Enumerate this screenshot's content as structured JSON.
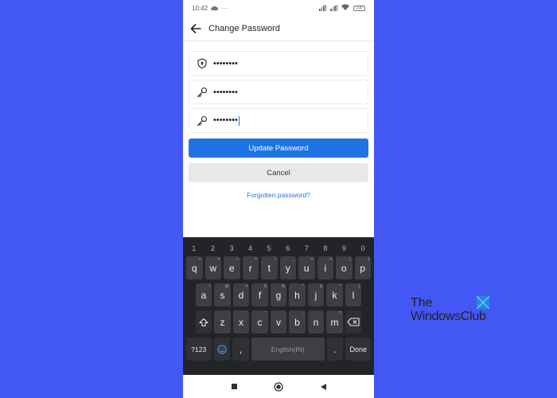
{
  "status_bar": {
    "time": "10:42",
    "battery_level": "100"
  },
  "header": {
    "title": "Change Password"
  },
  "form": {
    "current_password_value": "••••••••",
    "new_password_value": "••••••••",
    "confirm_password_value": "••••••••",
    "update_label": "Update Password",
    "cancel_label": "Cancel",
    "forgot_label": "Forgotten password?"
  },
  "keyboard": {
    "numbers": [
      "1",
      "2",
      "3",
      "4",
      "5",
      "6",
      "7",
      "8",
      "9",
      "0"
    ],
    "row1": [
      "q",
      "w",
      "e",
      "r",
      "t",
      "y",
      "u",
      "i",
      "o",
      "p"
    ],
    "row1_hints": [
      "+",
      "×",
      "÷",
      "=",
      "/",
      "_",
      "<",
      ">",
      "[",
      "]"
    ],
    "row2": [
      "a",
      "s",
      "d",
      "f",
      "g",
      "h",
      "j",
      "k",
      "l"
    ],
    "row2_hints": [
      "!",
      "@",
      "#",
      "$",
      "%",
      "^",
      "&",
      "*",
      "("
    ],
    "row3": [
      "z",
      "x",
      "c",
      "v",
      "b",
      "n",
      "m"
    ],
    "row3_hints": [
      "-",
      "'",
      "\"",
      ":",
      ";",
      ",",
      "?"
    ],
    "symbols_label": "?123",
    "comma_label": ",",
    "space_label": "English(IN)",
    "period_label": ".",
    "done_label": "Done",
    "shift_icon": "shift-icon",
    "backspace_icon": "backspace-icon",
    "emoji_icon": "emoji-icon"
  },
  "watermark": {
    "line1": "The",
    "line2": "WindowsClub"
  },
  "colors": {
    "background": "#4357f5",
    "primary": "#1e74e3",
    "keyboard": "#232428",
    "key": "#3d3f44"
  }
}
